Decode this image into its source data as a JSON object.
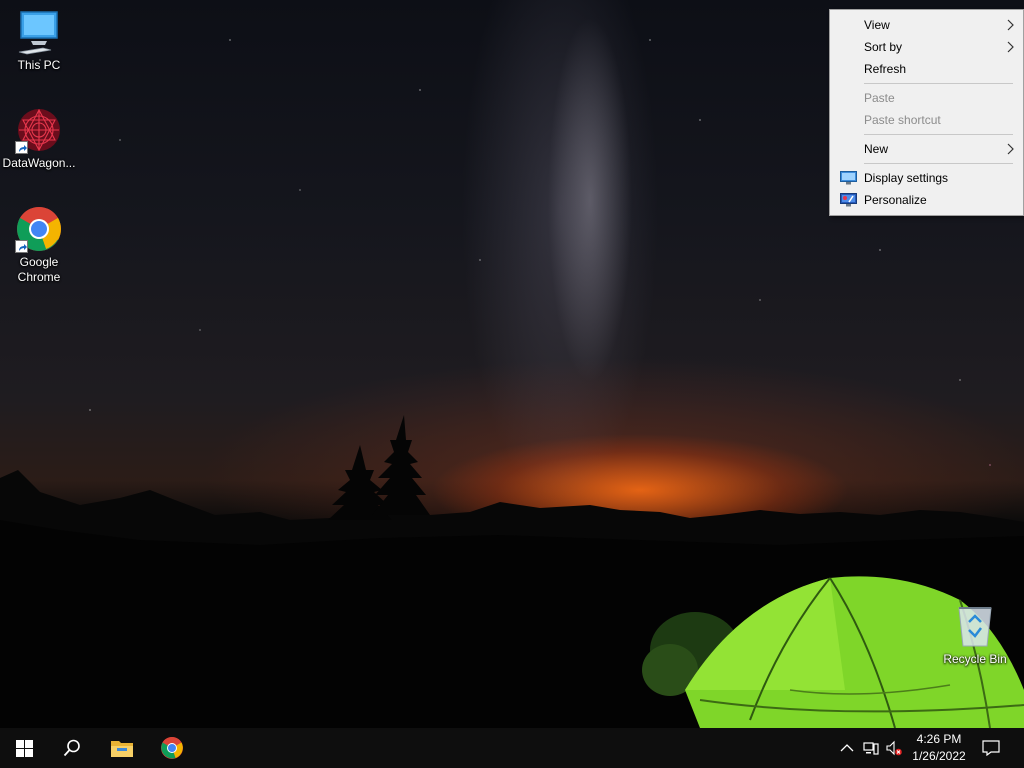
{
  "desktop": {
    "icons": [
      {
        "label": "This PC",
        "icon": "computer-icon"
      },
      {
        "label": "DataWagon...",
        "icon": "datawagon-icon"
      },
      {
        "label": "Google Chrome",
        "icon": "chrome-icon"
      },
      {
        "label": "Recycle Bin",
        "icon": "recycle-bin-icon"
      }
    ]
  },
  "context_menu": {
    "items": [
      {
        "label": "View",
        "has_submenu": true,
        "enabled": true
      },
      {
        "label": "Sort by",
        "has_submenu": true,
        "enabled": true
      },
      {
        "label": "Refresh",
        "enabled": true
      },
      {
        "label": "Paste",
        "enabled": false
      },
      {
        "label": "Paste shortcut",
        "enabled": false
      },
      {
        "label": "New",
        "has_submenu": true,
        "enabled": true
      },
      {
        "label": "Display settings",
        "icon": "display-icon",
        "enabled": true
      },
      {
        "label": "Personalize",
        "icon": "personalize-icon",
        "enabled": true
      }
    ]
  },
  "taskbar": {
    "pinned": [
      "start-icon",
      "search-icon",
      "file-explorer-icon",
      "chrome-icon"
    ],
    "tray": [
      "chevron-up-icon",
      "network-icon",
      "volume-muted-icon"
    ],
    "clock": {
      "time": "4:26 PM",
      "date": "1/26/2022"
    },
    "notifications_icon": "action-center-icon"
  },
  "colors": {
    "taskbar_bg": "#0e0e0e",
    "menu_bg": "#f0f0f0",
    "tent_green": "#7fd629",
    "horizon_orange": "#ff6e14"
  }
}
